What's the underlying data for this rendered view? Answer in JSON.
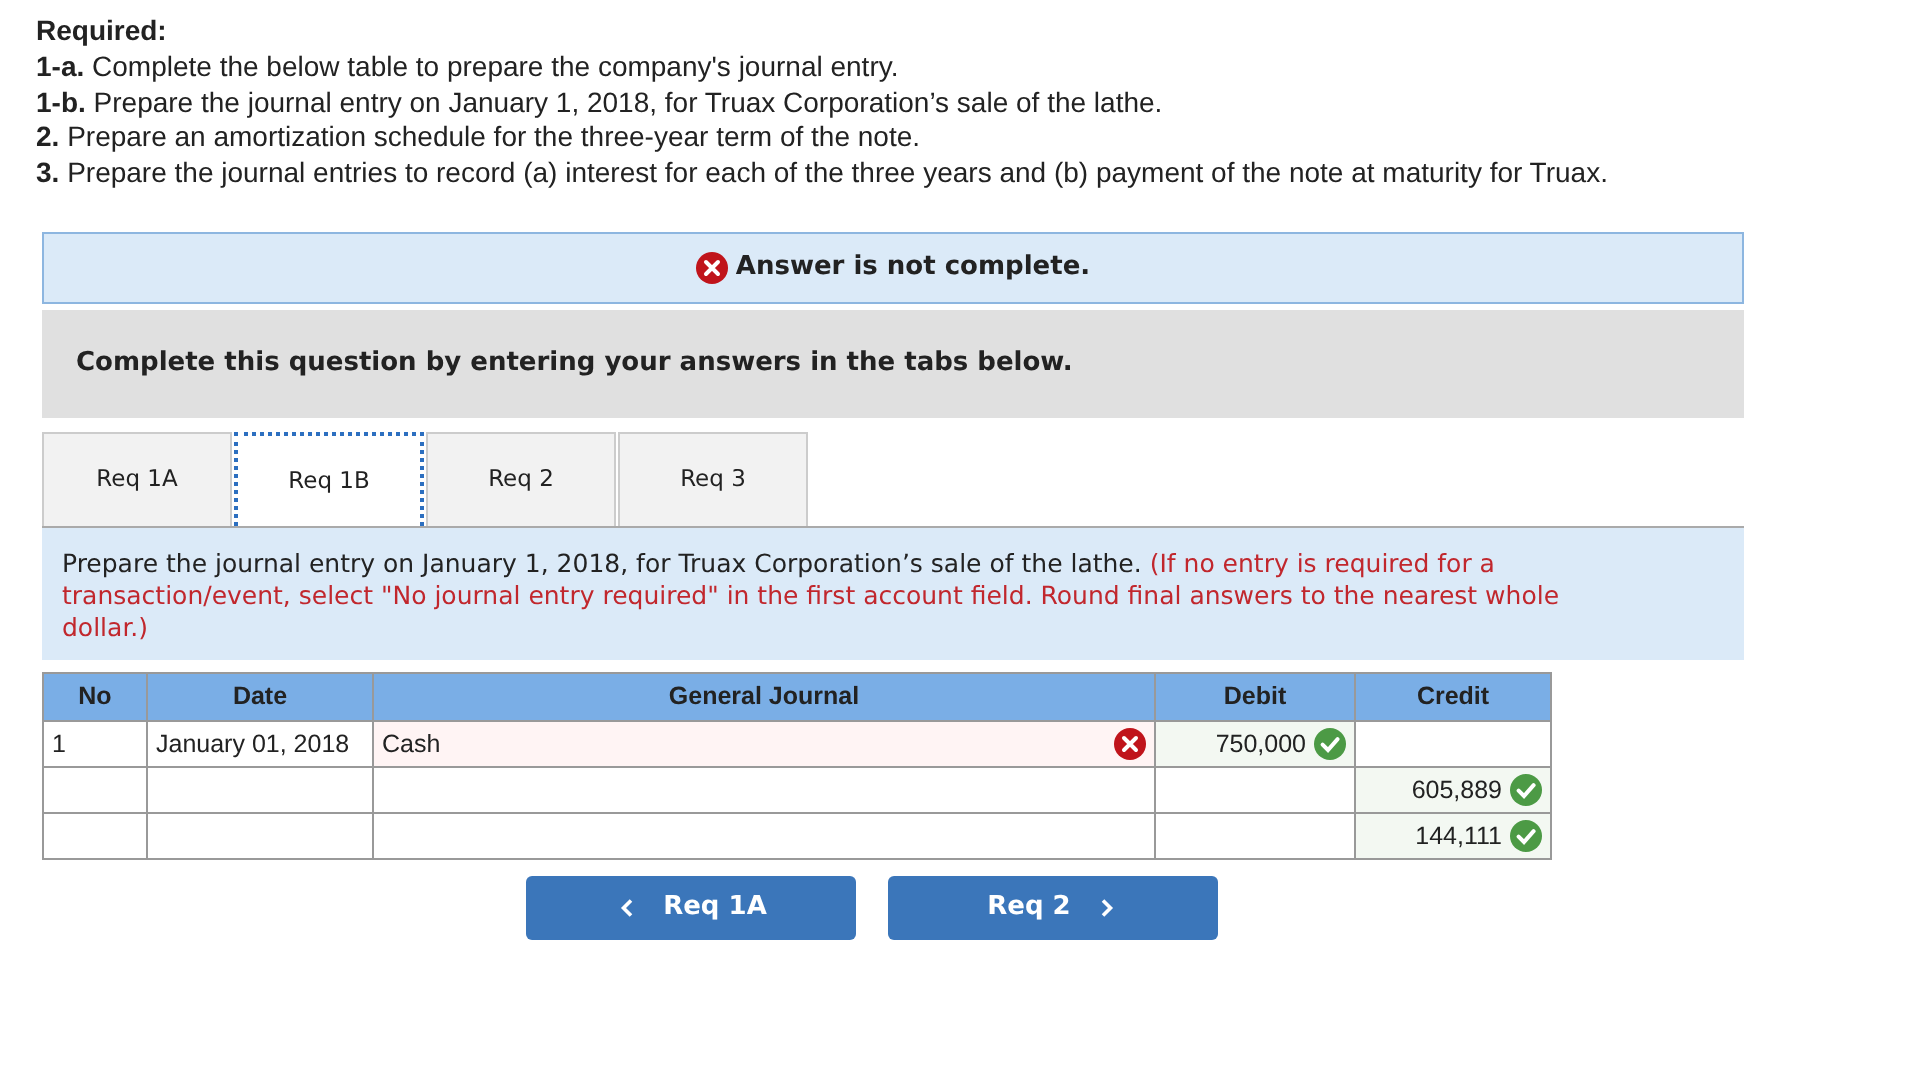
{
  "required": {
    "heading": "Required:",
    "items": [
      "**1-a.** Complete the below table to prepare the company's journal entry.",
      "**1-b.** Prepare the journal entry on January 1, 2018, for Truax Corporation’s sale of the lathe.",
      "**2.** Prepare an amortization schedule for the three-year term of the note.",
      "**3.** Prepare the journal entries to record (a) interest for each of the three years and (b) payment of the note at maturity for Truax."
    ]
  },
  "status": {
    "kind": "incomplete",
    "text": "Answer is not complete."
  },
  "banner": "Complete this question by entering your answers in the tabs below.",
  "tabs": [
    {
      "label": "Req 1A",
      "selected": false
    },
    {
      "label": "Req 1B",
      "selected": true
    },
    {
      "label": "Req 2",
      "selected": false
    },
    {
      "label": "Req 3",
      "selected": false
    }
  ],
  "instruction": {
    "text": "Prepare the journal entry on January 1, 2018, for Truax Corporation’s sale of the lathe.",
    "note": "(If no entry is required for a transaction/event, select \"No journal entry required\" in the first account field. Round final answers to the nearest whole dollar.)"
  },
  "table": {
    "columns": [
      "No",
      "Date",
      "General Journal",
      "Debit",
      "Credit"
    ],
    "rows": [
      [
        {
          "text": "1"
        },
        {
          "text": "January 01, 2018"
        },
        {
          "text": "Cash",
          "correct": false
        },
        {
          "text": "750,000",
          "correct": true
        },
        {}
      ],
      [
        {},
        {},
        {},
        {},
        {
          "text": "605,889",
          "correct": true
        }
      ],
      [
        {},
        {},
        {},
        {},
        {
          "text": "144,111",
          "correct": true
        }
      ]
    ]
  },
  "nav": [
    {
      "label": "Req 1A",
      "kind": "prev"
    },
    {
      "label": "Req 2",
      "kind": "next"
    }
  ]
}
